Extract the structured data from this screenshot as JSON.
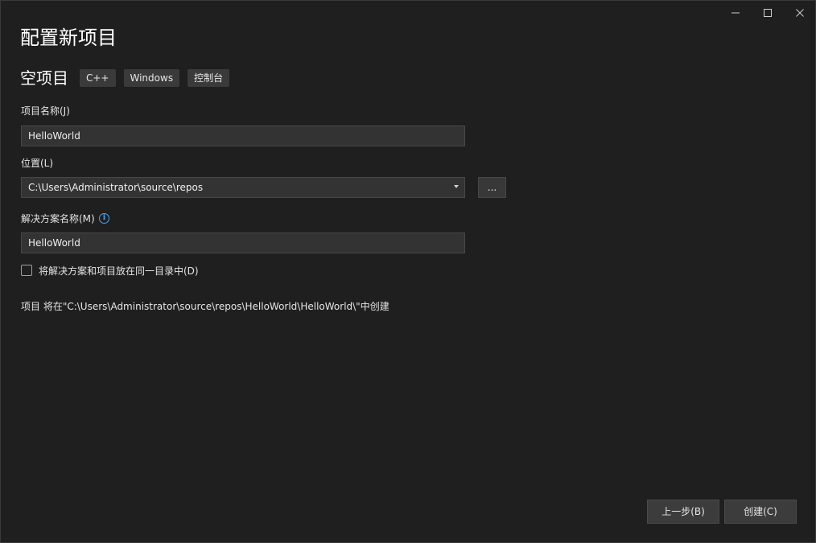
{
  "window": {
    "title": "配置新项目",
    "subtitle": "空项目",
    "tags": [
      "C++",
      "Windows",
      "控制台"
    ]
  },
  "form": {
    "project_name_label": "项目名称(J)",
    "project_name_value": "HelloWorld",
    "location_label": "位置(L)",
    "location_value": "C:\\Users\\Administrator\\source\\repos",
    "browse_label": "...",
    "solution_name_label": "解决方案名称(M)",
    "solution_name_value": "HelloWorld",
    "same_dir_label": "将解决方案和项目放在同一目录中(D)",
    "path_note": "项目 将在\"C:\\Users\\Administrator\\source\\repos\\HelloWorld\\HelloWorld\\\"中创建"
  },
  "footer": {
    "back_label": "上一步(B)",
    "create_label": "创建(C)"
  },
  "icons": {
    "minimize": "minimize-icon",
    "maximize": "maximize-icon",
    "close": "close-icon",
    "info": "info-icon",
    "dropdown": "chevron-down-icon"
  },
  "colors": {
    "background": "#1f1f1f",
    "field": "#333333",
    "info": "#4ea3f1"
  }
}
